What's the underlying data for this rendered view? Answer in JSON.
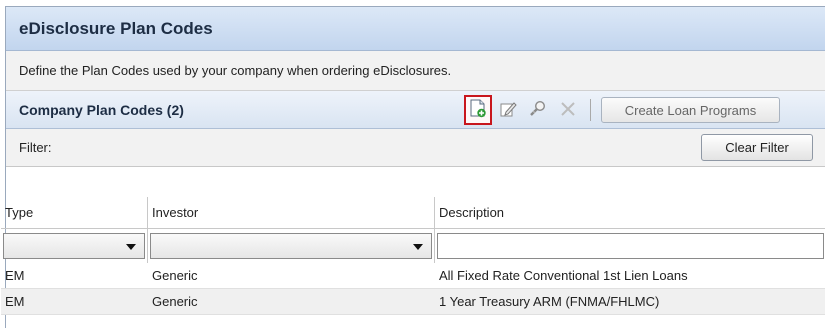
{
  "panel": {
    "title": "eDisclosure Plan Codes",
    "description": "Define the Plan Codes used by your company when ordering eDisclosures."
  },
  "section": {
    "title": "Company Plan Codes (2)",
    "create_label": "Create Loan Programs"
  },
  "filter": {
    "label": "Filter:",
    "clear_label": "Clear Filter"
  },
  "grid": {
    "columns": [
      "Type",
      "Investor",
      "Description"
    ],
    "rows": [
      {
        "type": "EM",
        "investor": "Generic",
        "description": "All Fixed Rate Conventional 1st Lien Loans"
      },
      {
        "type": "EM",
        "investor": "Generic",
        "description": "1 Year Treasury ARM (FNMA/FHLMC)"
      }
    ]
  },
  "icons": [
    "new-document-icon",
    "edit-icon",
    "find-icon",
    "delete-icon"
  ],
  "colors": {
    "title_bar": "#c2d5ee",
    "highlight": "#c8161d"
  }
}
